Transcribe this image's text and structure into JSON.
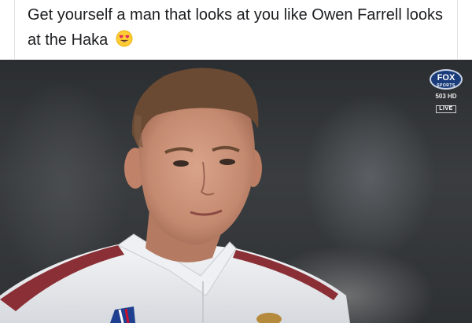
{
  "post": {
    "caption": "Get yourself a man that looks at you like Owen Farrell looks at the Haka",
    "emoji": "heart-eyes-emoji"
  },
  "broadcast": {
    "network": "FOX",
    "network_sub": "SPORTS",
    "channel": "503 HD",
    "live_label": "LIVE"
  },
  "photo": {
    "subject": "man-portrait-photo"
  }
}
